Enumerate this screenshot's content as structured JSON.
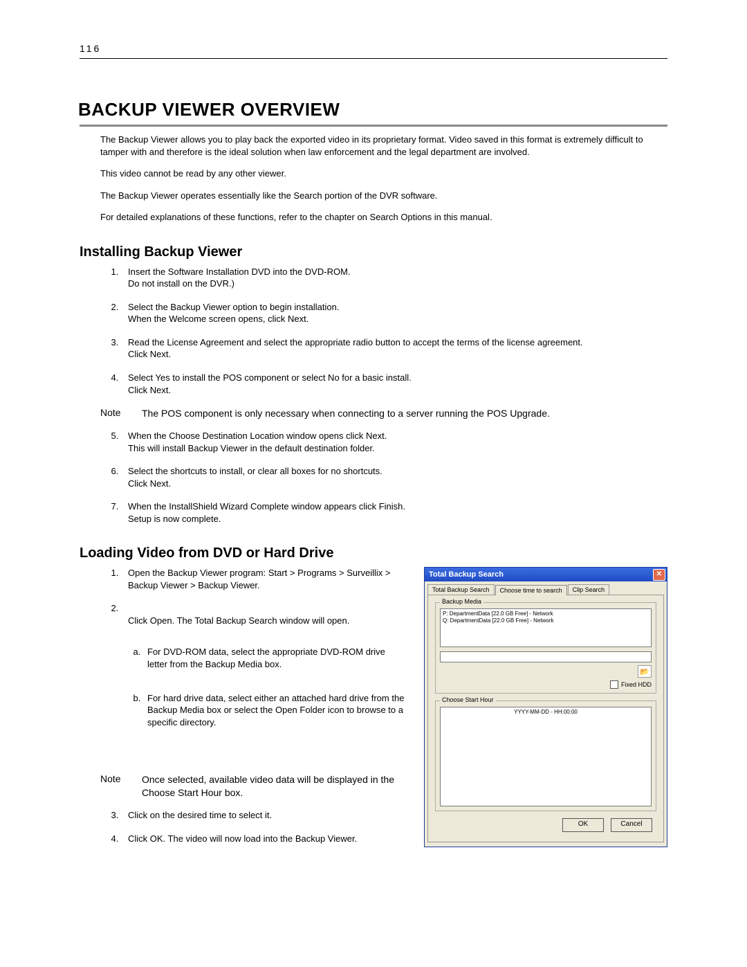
{
  "page_number": "116",
  "h1": "BACKUP VIEWER OVERVIEW",
  "overview": {
    "p1": "The Backup Viewer allows you to play back the exported video in its proprietary format.  Video saved in this format is extremely difficult to tamper with and therefore is the ideal solution when law enforcement and the legal department are involved.",
    "p2": "This video cannot be read by any other viewer.",
    "p3": "The Backup Viewer operates essentially like the Search portion of the DVR software.",
    "p4": "For detailed explanations of these functions, refer to the chapter on Search Options in this manual."
  },
  "installing": {
    "heading": "Installing Backup Viewer",
    "steps": [
      "Insert the Software Installation DVD into the DVD-ROM.\nDo not install on the DVR.)",
      "Select the Backup Viewer option to begin installation.\nWhen the Welcome screen opens, click Next.",
      "Read the License Agreement and select the appropriate radio button to accept the terms of the license agreement.\nClick Next.",
      "Select Yes to install the POS component or select No for a basic install.\nClick Next."
    ],
    "note_label": "Note",
    "note_text": "The POS component is only necessary when connecting to a server running the POS Upgrade.",
    "steps2": [
      "When the Choose Destination Location window opens click Next.\nThis will install Backup Viewer in the default destination folder.",
      "Select the shortcuts to install, or clear all boxes for no shortcuts.\nClick Next.",
      "When the InstallShield Wizard Complete window appears click Finish.\nSetup is now complete."
    ]
  },
  "loading": {
    "heading": "Loading Video from DVD or Hard Drive",
    "steps_a": [
      "Open the Backup Viewer program: Start > Programs > Surveillix > Backup Viewer > Backup Viewer.",
      "Click Open. The Total Backup Search window will open."
    ],
    "sub_a": "For DVD-ROM data, select the appropriate DVD-ROM drive letter from the Backup Media box.",
    "sub_b": "For hard drive data, select either an attached hard drive from the Backup Media box or select the Open Folder icon to browse to a specific directory.",
    "note_label": "Note",
    "note_text": "Once selected, available video data will be displayed in the Choose Start Hour box.",
    "steps_b": [
      "Click on the desired time to select it.",
      "Click OK.  The video will now load into the Backup Viewer."
    ]
  },
  "dialog": {
    "title": "Total Backup Search",
    "tabs": [
      "Total Backup Search",
      "Choose time to search",
      "Clip Search"
    ],
    "group_media": "Backup Media",
    "drives": [
      "P:  DepartmentData [22.0 GB Free] - Network",
      "Q:  DepartmentData [22.0 GB Free] - Network"
    ],
    "fixed_hdd": "Fixed HDD",
    "group_hour": "Choose Start Hour",
    "hour_placeholder": "YYYY-MM-DD - HH:00:00",
    "ok": "OK",
    "cancel": "Cancel",
    "folder_glyph": "📂",
    "close_glyph": "✕"
  }
}
